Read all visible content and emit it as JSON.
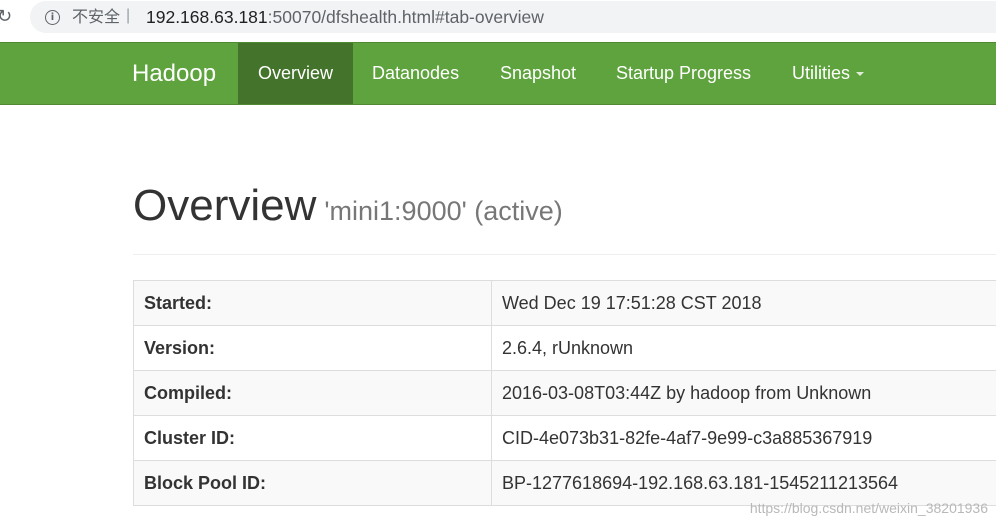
{
  "browser": {
    "reload_glyph": "↻",
    "info_glyph": "i",
    "security_label": "不安全",
    "separator": "|",
    "url_host": "192.168.63.181",
    "url_rest": ":50070/dfshealth.html#tab-overview"
  },
  "navbar": {
    "brand": "Hadoop",
    "items": [
      {
        "label": "Overview",
        "active": true
      },
      {
        "label": "Datanodes"
      },
      {
        "label": "Snapshot"
      },
      {
        "label": "Startup Progress"
      },
      {
        "label": "Utilities",
        "dropdown": true
      }
    ],
    "colors": {
      "background": "#5fa33e",
      "active": "#44732b"
    }
  },
  "header": {
    "title": "Overview",
    "subtitle": "'mini1:9000' (active)"
  },
  "info": [
    {
      "label": "Started:",
      "value": "Wed Dec 19 17:51:28 CST 2018"
    },
    {
      "label": "Version:",
      "value": "2.6.4, rUnknown"
    },
    {
      "label": "Compiled:",
      "value": "2016-03-08T03:44Z by hadoop from Unknown"
    },
    {
      "label": "Cluster ID:",
      "value": "CID-4e073b31-82fe-4af7-9e99-c3a885367919"
    },
    {
      "label": "Block Pool ID:",
      "value": "BP-1277618694-192.168.63.181-1545211213564"
    }
  ],
  "watermark": "https://blog.csdn.net/weixin_38201936"
}
